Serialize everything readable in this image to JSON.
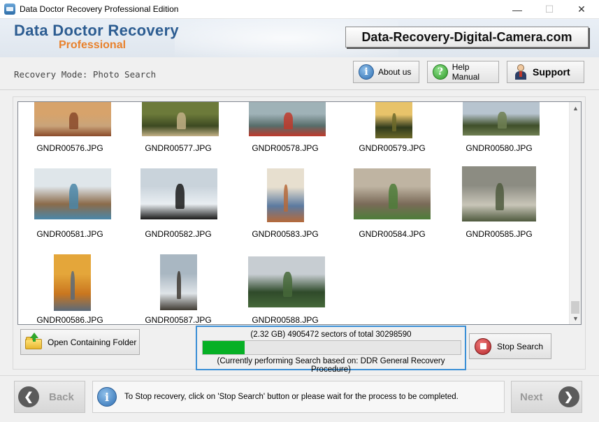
{
  "window": {
    "title": "Data Doctor Recovery Professional Edition",
    "minimize_glyph": "—",
    "maximize_glyph": "☐",
    "close_glyph": "✕"
  },
  "header": {
    "brand_main": "Data Doctor Recovery",
    "brand_sub": "Professional",
    "url": "Data-Recovery-Digital-Camera.com"
  },
  "toolbar": {
    "mode_label": "Recovery Mode: Photo Search",
    "about_label": "About us",
    "help_label": "Help Manual",
    "support_label": "Support",
    "about_icon": "info-icon",
    "help_icon": "question-icon",
    "support_icon": "support-person-icon"
  },
  "gallery": {
    "items": [
      {
        "name": "GNDR00576.JPG",
        "colors": [
          "#d7a36b",
          "#8a4a2a",
          "#c9a47a"
        ]
      },
      {
        "name": "GNDR00577.JPG",
        "colors": [
          "#6c7a3a",
          "#c2b086",
          "#3d4a22"
        ]
      },
      {
        "name": "GNDR00578.JPG",
        "colors": [
          "#9fb2b7",
          "#c0392b",
          "#576d6a"
        ]
      },
      {
        "name": "GNDR00579.JPG",
        "colors": [
          "#e8c36a",
          "#6d6a2a",
          "#2f3a1c"
        ]
      },
      {
        "name": "GNDR00580.JPG",
        "colors": [
          "#b7c4cf",
          "#6f7f52",
          "#3f4f2a"
        ]
      },
      {
        "name": "GNDR00581.JPG",
        "colors": [
          "#dfe6ea",
          "#4a86a8",
          "#8b6b4a"
        ]
      },
      {
        "name": "GNDR00582.JPG",
        "colors": [
          "#c9d3db",
          "#1a1a1a",
          "#e9eef2"
        ]
      },
      {
        "name": "GNDR00583.JPG",
        "colors": [
          "#e7dfcf",
          "#b66a3a",
          "#5c7aa0"
        ]
      },
      {
        "name": "GNDR00584.JPG",
        "colors": [
          "#bfb4a2",
          "#4e7d3a",
          "#7a6a58"
        ]
      },
      {
        "name": "GNDR00585.JPG",
        "colors": [
          "#8c8c82",
          "#4f5a3e",
          "#c8c5b8"
        ]
      },
      {
        "name": "GNDR00586.JPG",
        "colors": [
          "#e4a63a",
          "#5b6a7a",
          "#c9761f"
        ]
      },
      {
        "name": "GNDR00587.JPG",
        "colors": [
          "#a9b7c2",
          "#3f3a32",
          "#dfe4e8"
        ]
      },
      {
        "name": "GNDR00588.JPG",
        "colors": [
          "#c7cdd2",
          "#46693a",
          "#2f4a2a"
        ]
      }
    ]
  },
  "actions": {
    "open_folder_label": "Open Containing Folder",
    "folder_icon": "folder-icon",
    "stop_label": "Stop Search",
    "stop_icon": "stop-icon"
  },
  "progress": {
    "line1": "(2.32 GB) 4905472  sectors  of  total 30298590",
    "line2": "(Currently performing Search based on:  DDR General Recovery Procedure)",
    "fraction": 0.162,
    "color": "#06b025"
  },
  "footer": {
    "back_label": "Back",
    "next_label": "Next",
    "info_text": "To Stop recovery, click on 'Stop Search' button or please wait for the process to be completed.",
    "info_icon": "info-icon"
  }
}
